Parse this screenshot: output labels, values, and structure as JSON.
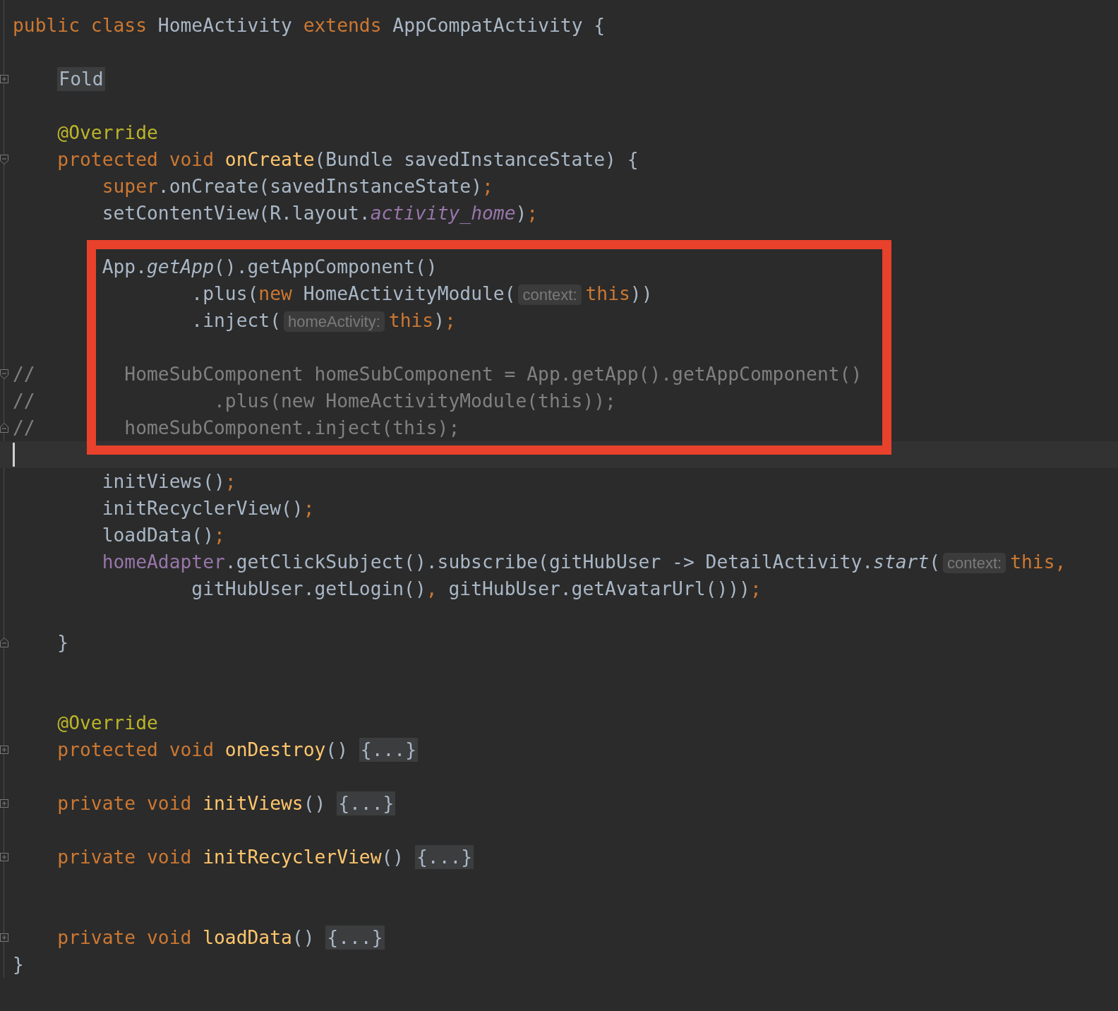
{
  "editor": {
    "lines": [
      {
        "current": false,
        "boxed": false,
        "tokens": [
          {
            "kind": "kw",
            "text": "public class "
          },
          {
            "kind": "plain",
            "text": "HomeActivity "
          },
          {
            "kind": "kw",
            "text": "extends "
          },
          {
            "kind": "plain",
            "text": "AppCompatActivity {"
          }
        ]
      },
      {
        "current": false,
        "boxed": false
      },
      {
        "current": false,
        "boxed": false,
        "gutter": {
          "kind": "plus"
        },
        "tokens": [
          {
            "kind": "fold-block",
            "text": "Fold"
          }
        ]
      },
      {
        "current": false,
        "boxed": false
      },
      {
        "current": false,
        "boxed": false,
        "tokens": [
          {
            "kind": "annot",
            "text": "    @Override"
          }
        ]
      },
      {
        "current": false,
        "boxed": false,
        "gutter": {
          "kind": "start"
        },
        "tokens": [
          {
            "kind": "kw",
            "text": "    protected void "
          },
          {
            "kind": "decl",
            "text": "onCreate"
          },
          {
            "kind": "plain",
            "text": "(Bundle savedInstanceState) {"
          }
        ]
      },
      {
        "current": false,
        "boxed": false,
        "tokens": [
          {
            "kind": "kw",
            "text": "        super"
          },
          {
            "kind": "plain",
            "text": ".onCreate(savedInstanceState)"
          },
          {
            "kind": "kw",
            "text": ";"
          }
        ]
      },
      {
        "current": false,
        "boxed": false,
        "tokens": [
          {
            "kind": "plain",
            "text": "        setContentView(R.layout."
          },
          {
            "kind": "static-field",
            "text": "activity_home"
          },
          {
            "kind": "plain",
            "text": ")"
          },
          {
            "kind": "kw",
            "text": ";"
          }
        ]
      },
      {
        "current": false,
        "boxed": false
      },
      {
        "current": false,
        "boxed": true,
        "tokens": [
          {
            "kind": "plain",
            "text": "        App."
          },
          {
            "kind": "static",
            "text": "getApp"
          },
          {
            "kind": "plain",
            "text": "().getAppComponent()"
          }
        ]
      },
      {
        "current": false,
        "boxed": true,
        "tokens": [
          {
            "kind": "plain",
            "text": "                .plus("
          },
          {
            "kind": "kw",
            "text": "new "
          },
          {
            "kind": "plain",
            "text": "HomeActivityModule("
          },
          {
            "kind": "hint",
            "text": "context:"
          },
          {
            "kind": "kw",
            "text": "this"
          },
          {
            "kind": "plain",
            "text": "))"
          }
        ]
      },
      {
        "current": false,
        "boxed": true,
        "tokens": [
          {
            "kind": "plain",
            "text": "                .inject("
          },
          {
            "kind": "hint",
            "text": "homeActivity:"
          },
          {
            "kind": "kw",
            "text": "this"
          },
          {
            "kind": "plain",
            "text": ")"
          },
          {
            "kind": "kw",
            "text": ";"
          }
        ]
      },
      {
        "current": false,
        "boxed": true
      },
      {
        "current": false,
        "boxed": true,
        "gutter": {
          "kind": "start"
        },
        "tokens": [
          {
            "kind": "comment",
            "text": "//        HomeSubComponent homeSubComponent = App.getApp().getAppComponent()"
          }
        ]
      },
      {
        "current": false,
        "boxed": true,
        "tokens": [
          {
            "kind": "comment",
            "text": "//                .plus(new HomeActivityModule(this));"
          }
        ]
      },
      {
        "current": false,
        "boxed": true,
        "gutter": {
          "kind": "end"
        },
        "tokens": [
          {
            "kind": "comment",
            "text": "//        homeSubComponent.inject(this);"
          }
        ]
      },
      {
        "current": true,
        "boxed": false
      },
      {
        "current": false,
        "boxed": false,
        "tokens": [
          {
            "kind": "plain",
            "text": "        initViews()"
          },
          {
            "kind": "kw",
            "text": ";"
          }
        ]
      },
      {
        "current": false,
        "boxed": false,
        "tokens": [
          {
            "kind": "plain",
            "text": "        initRecyclerView()"
          },
          {
            "kind": "kw",
            "text": ";"
          }
        ]
      },
      {
        "current": false,
        "boxed": false,
        "tokens": [
          {
            "kind": "plain",
            "text": "        loadData()"
          },
          {
            "kind": "kw",
            "text": ";"
          }
        ]
      },
      {
        "current": false,
        "boxed": false,
        "tokens": [
          {
            "kind": "field",
            "text": "        homeAdapter"
          },
          {
            "kind": "plain",
            "text": ".getClickSubject().subscribe(gitHubUser -> DetailActivity."
          },
          {
            "kind": "static",
            "text": "start"
          },
          {
            "kind": "plain",
            "text": "("
          },
          {
            "kind": "hint",
            "text": "context:"
          },
          {
            "kind": "kw",
            "text": "this,"
          }
        ]
      },
      {
        "current": false,
        "boxed": false,
        "tokens": [
          {
            "kind": "plain",
            "text": "                gitHubUser.getLogin()"
          },
          {
            "kind": "kw",
            "text": ", "
          },
          {
            "kind": "plain",
            "text": "gitHubUser.getAvatarUrl()))"
          },
          {
            "kind": "kw",
            "text": ";"
          }
        ]
      },
      {
        "current": false,
        "boxed": false
      },
      {
        "current": false,
        "boxed": false,
        "gutter": {
          "kind": "end"
        },
        "tokens": [
          {
            "kind": "plain",
            "text": "    }"
          }
        ]
      },
      {
        "current": false,
        "boxed": false
      },
      {
        "current": false,
        "boxed": false
      },
      {
        "current": false,
        "boxed": false,
        "tokens": [
          {
            "kind": "annot",
            "text": "    @Override"
          }
        ]
      },
      {
        "current": false,
        "boxed": false,
        "gutter": {
          "kind": "plus"
        },
        "tokens": [
          {
            "kind": "kw",
            "text": "    protected void "
          },
          {
            "kind": "decl",
            "text": "onDestroy"
          },
          {
            "kind": "plain",
            "text": "() "
          },
          {
            "kind": "fold",
            "text": "{...}"
          }
        ]
      },
      {
        "current": false,
        "boxed": false
      },
      {
        "current": false,
        "boxed": false,
        "gutter": {
          "kind": "plus"
        },
        "tokens": [
          {
            "kind": "kw",
            "text": "    private void "
          },
          {
            "kind": "decl",
            "text": "initViews"
          },
          {
            "kind": "plain",
            "text": "() "
          },
          {
            "kind": "fold",
            "text": "{...}"
          }
        ]
      },
      {
        "current": false,
        "boxed": false
      },
      {
        "current": false,
        "boxed": false,
        "gutter": {
          "kind": "plus"
        },
        "tokens": [
          {
            "kind": "kw",
            "text": "    private void "
          },
          {
            "kind": "decl",
            "text": "initRecyclerView"
          },
          {
            "kind": "plain",
            "text": "() "
          },
          {
            "kind": "fold",
            "text": "{...}"
          }
        ]
      },
      {
        "current": false,
        "boxed": false
      },
      {
        "current": false,
        "boxed": false
      },
      {
        "current": false,
        "boxed": false,
        "gutter": {
          "kind": "plus"
        },
        "tokens": [
          {
            "kind": "kw",
            "text": "    private void "
          },
          {
            "kind": "decl",
            "text": "loadData"
          },
          {
            "kind": "plain",
            "text": "() "
          },
          {
            "kind": "fold",
            "text": "{...}"
          }
        ]
      },
      {
        "current": false,
        "boxed": false,
        "tokens": [
          {
            "kind": "plain",
            "text": "}"
          }
        ]
      }
    ]
  }
}
